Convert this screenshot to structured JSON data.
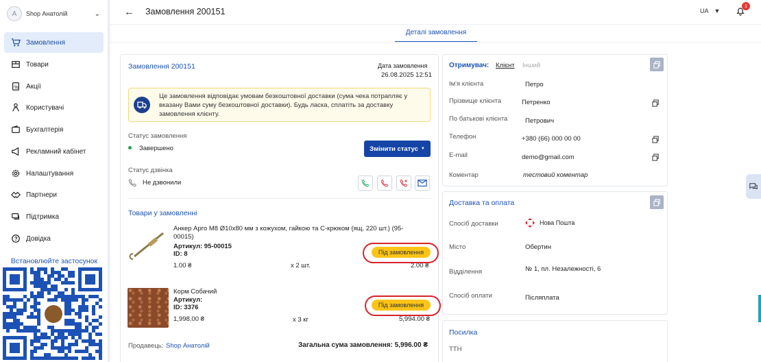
{
  "sidebar": {
    "shop_initial": "A",
    "shop_name": "Shop Анатолій",
    "items": [
      {
        "label": "Замовлення",
        "icon": "cart-icon"
      },
      {
        "label": "Товари",
        "icon": "box-icon"
      },
      {
        "label": "Акції",
        "icon": "promo-icon"
      },
      {
        "label": "Користувачі",
        "icon": "users-icon"
      },
      {
        "label": "Бухгалтерія",
        "icon": "wallet-icon"
      },
      {
        "label": "Рекламний кабінет",
        "icon": "megaphone-icon"
      },
      {
        "label": "Налаштування",
        "icon": "gear-icon"
      },
      {
        "label": "Партнери",
        "icon": "handshake-icon"
      },
      {
        "label": "Підтримка",
        "icon": "chat-icon"
      },
      {
        "label": "Довідка",
        "icon": "help-icon"
      }
    ],
    "install_label": "Встановлюйте застосунок"
  },
  "header": {
    "title": "Замовлення 200151",
    "lang": "UA",
    "notif_count": "1"
  },
  "tab": "Деталі замовлення",
  "order": {
    "title": "Замовлення 200151",
    "date_label": "Дата замовлення",
    "date": "26.08.2025 12:51",
    "alert": "Це замовлення відповідає умовам безкоштовної доставки (сума чека потрапляє у вказану Вами суму безкоштовної доставки). Будь ласка, сплатіть за доставку замовлення клієнту.",
    "status_label": "Статус замовлення",
    "status": "Завершено",
    "change_status": "Змінити статус",
    "call_label": "Статус дзвінка",
    "call_status": "Не дзвонили",
    "goods_title": "Товари у замовленні",
    "items": [
      {
        "name": "Анкер Арго М8 Ø10х80 мм з кожухом, гайкою та С-крюком (ящ. 220 шт.) (95-00015)",
        "article": "Артикул: 95-00015",
        "id": "ID: 8",
        "price": "1.00 ₴",
        "qty": "x 2 шт.",
        "total": "2.00 ₴",
        "tag": "Під замовлення"
      },
      {
        "name": "Корм Собачий",
        "article": "Артикул:",
        "id": "ID: 3376",
        "price": "1,998.00 ₴",
        "qty": "x 3 кг",
        "total": "5,994.00 ₴",
        "tag": "Під замовлення"
      }
    ],
    "seller_label": "Продавець:",
    "seller": "Shop Анатолій",
    "sum_label": "Загальна сума замовлення: 5,996.00 ₴"
  },
  "recipient": {
    "title": "Отримувач:",
    "tab_client": "Клієнт",
    "tab_other": "Інший",
    "rows": [
      {
        "label": "Ім'я клієнта",
        "value": "Петро"
      },
      {
        "label": "Прізвище клієнта",
        "value": "Петренко"
      },
      {
        "label": "По батькові клієнта",
        "value": "Петрович"
      },
      {
        "label": "Телефон",
        "value": "+380 (66) 000 00 00"
      },
      {
        "label": "E-mail",
        "value": "demo@gmail.com"
      },
      {
        "label": "Коментар",
        "value": "тестовий коментар"
      }
    ]
  },
  "delivery": {
    "title": "Доставка та оплата",
    "rows": [
      {
        "label": "Спосіб доставки",
        "value": "Нова Пошта"
      },
      {
        "label": "Місто",
        "value": "Обертин"
      },
      {
        "label": "Відділення",
        "value": "№ 1, пл. Незалежності, 6"
      },
      {
        "label": "Спосіб оплати",
        "value": "Післяплата"
      }
    ]
  },
  "parcel": {
    "title": "Посилка",
    "ttn": "ТТН"
  }
}
